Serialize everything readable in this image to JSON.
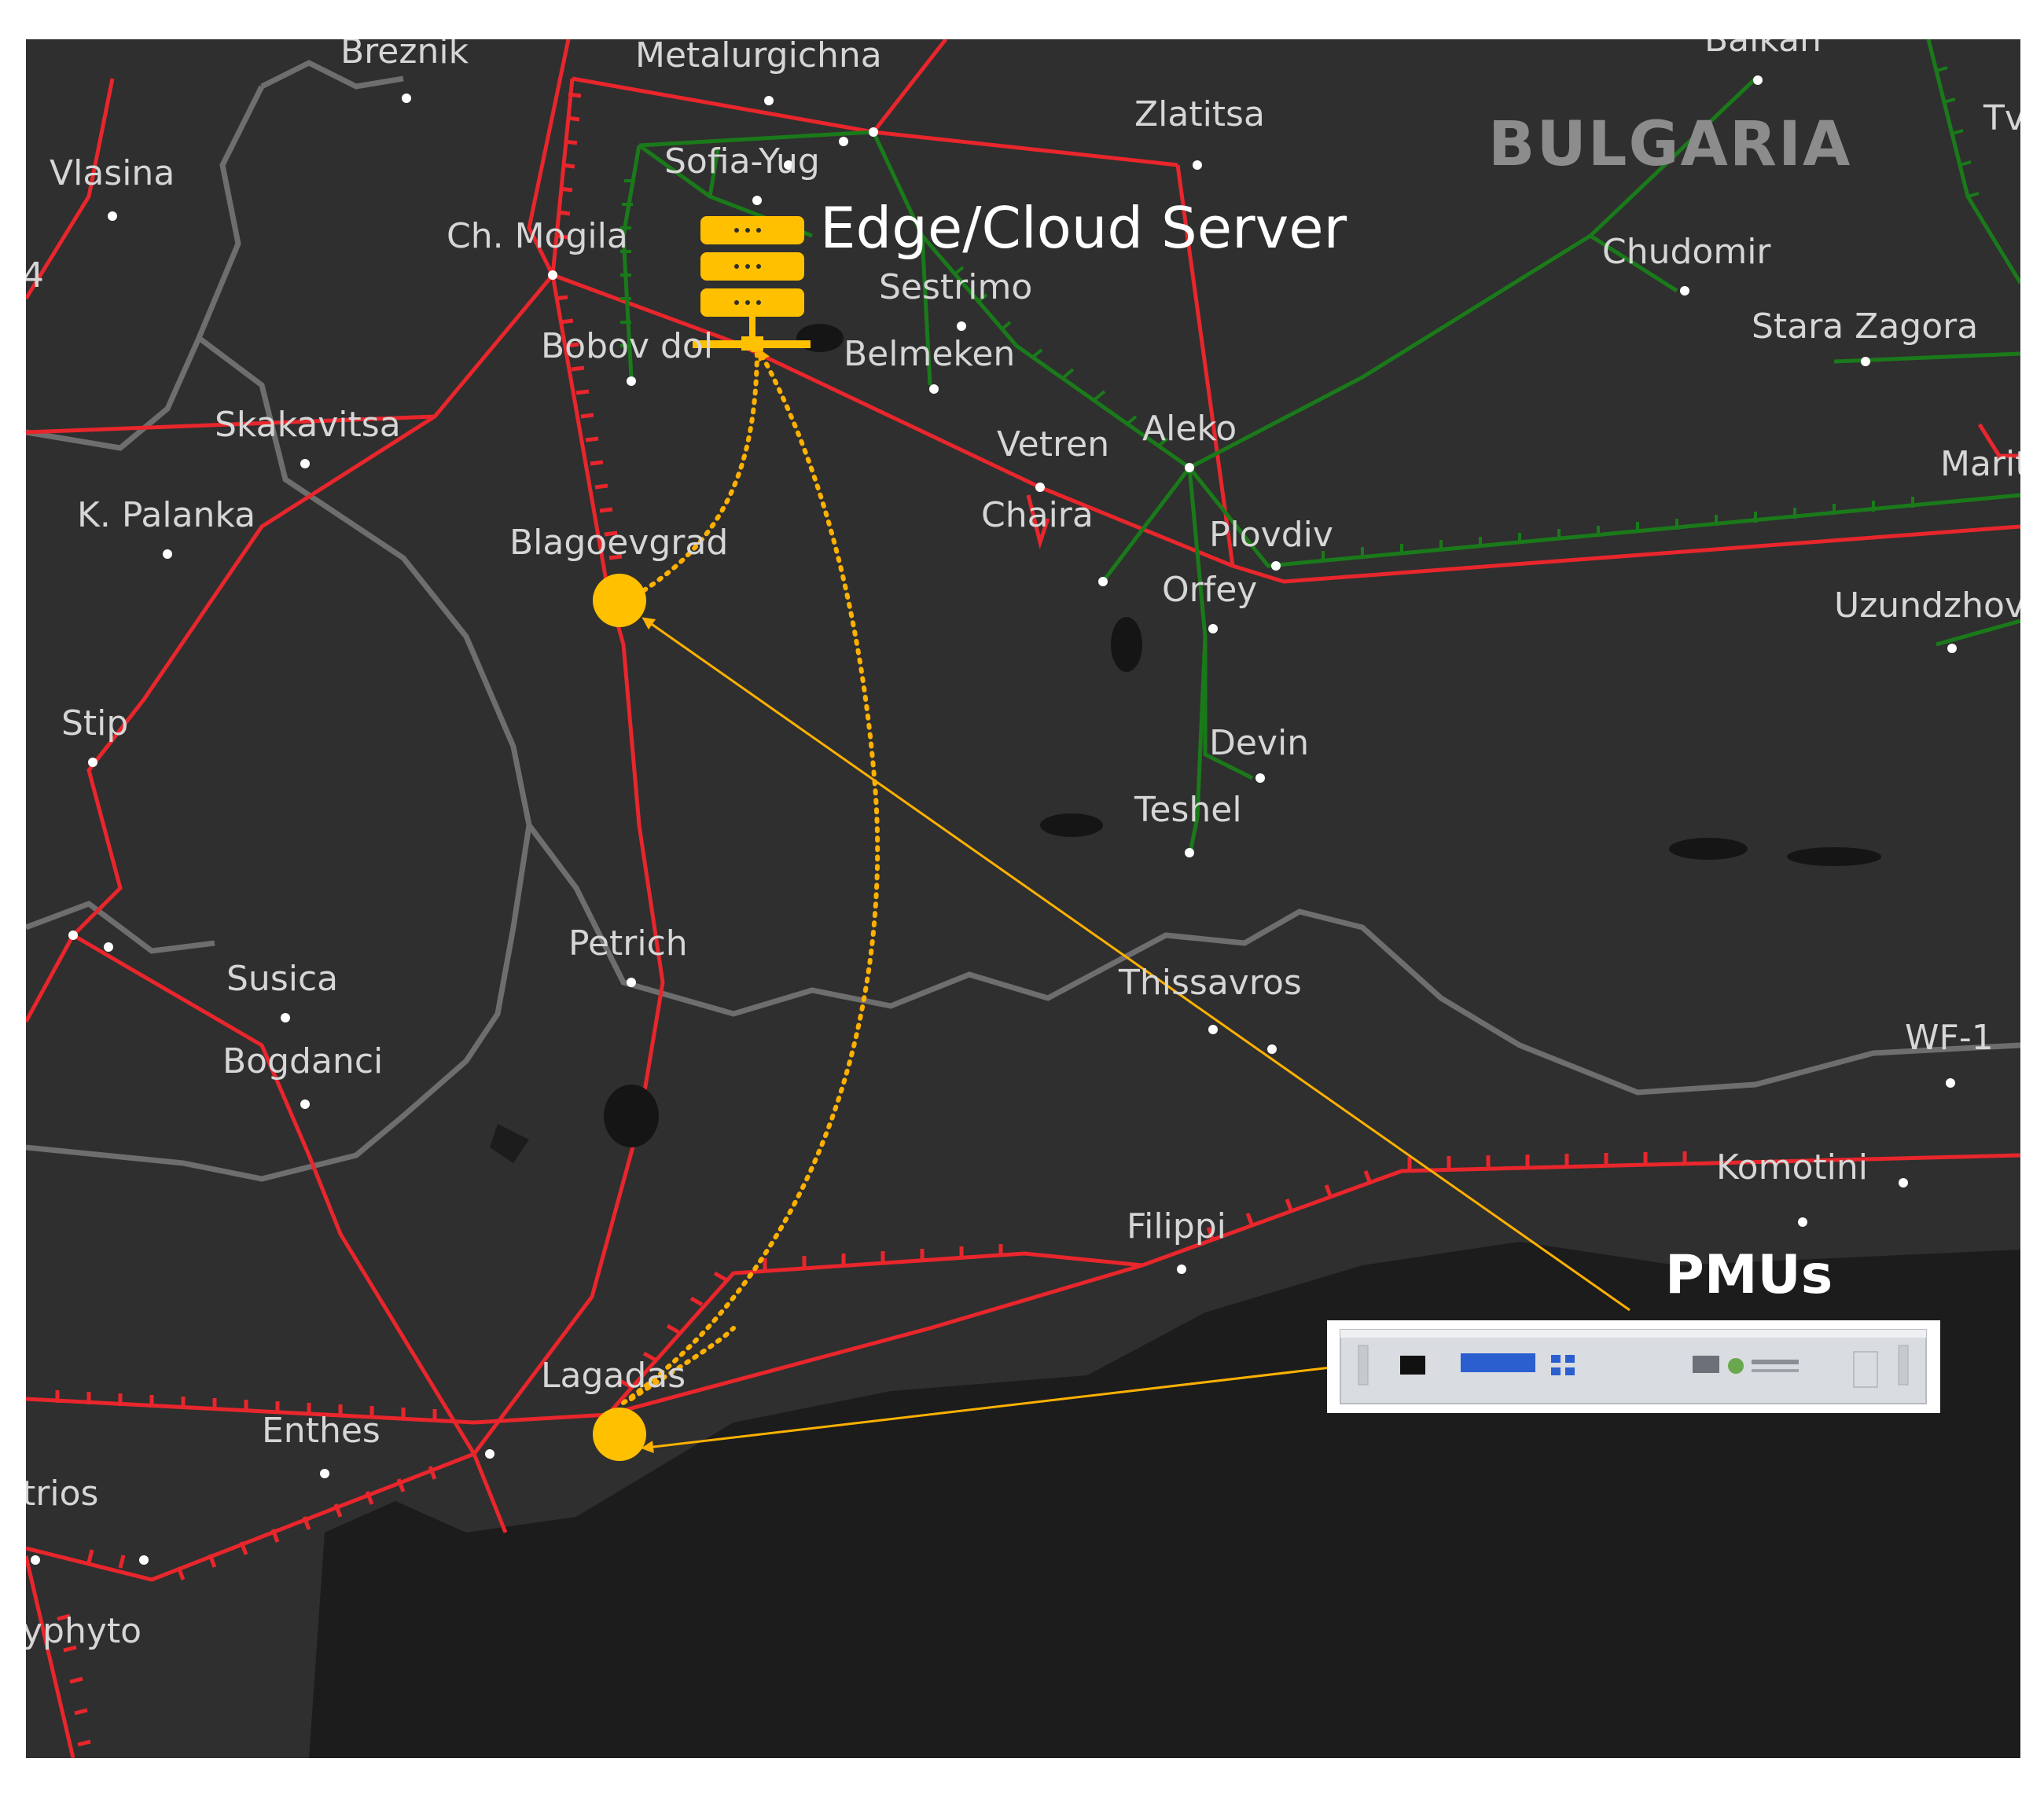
{
  "country_label": "BULGARIA",
  "server": {
    "label": "Edge/Cloud Server",
    "icon": "server-stack-icon",
    "color": "#ffc000"
  },
  "pmu": {
    "label": "PMUs",
    "nodes": [
      "Blagoevgrad",
      "Lagadas"
    ],
    "node_color": "#ffc000"
  },
  "places": [
    "Breznik",
    "Metalurgichna",
    "Zlatitsa",
    "Vlasina",
    "Sofia-Yug",
    "Ch. Mogila",
    "Sestrimo",
    "Bobov dol",
    "Belmeken",
    "Skakavitsa",
    "Vetren",
    "Aleko",
    "K. Palanka",
    "Chaira",
    "Plovdiv",
    "Blagoevgrad",
    "Orfey",
    "Stip",
    "Devin",
    "Teshel",
    "Petrich",
    "Susica",
    "Thissavros",
    "Bogdanci",
    "Filippi",
    "Komotini",
    "Lagadas",
    "Enthes",
    "Chudomir",
    "Stara Zagora",
    "Uzundzhov",
    "WF-1",
    "Balkan",
    "Marit",
    "Tv",
    "trios",
    "yphyto",
    "4"
  ],
  "legend_colors": {
    "line_red": "#e8262c",
    "line_green": "#1a7a1a",
    "link_yellow": "#ffb100"
  }
}
